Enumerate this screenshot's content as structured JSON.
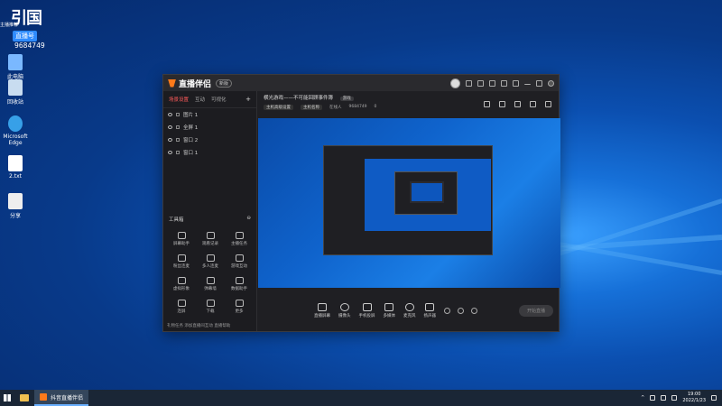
{
  "desktop": {
    "logo": {
      "big_text": "引国",
      "tag_text": "主播推荐",
      "badge_text": "直播号",
      "number": "9684749"
    },
    "icons": [
      {
        "label": "此电脑",
        "color": "#7ab8ff"
      },
      {
        "label": "回收站",
        "color": "#c8dcf0"
      },
      {
        "label": "Microsoft Edge",
        "color": "#37a0e8"
      },
      {
        "label": "2.txt",
        "color": "#ffffff"
      },
      {
        "label": "分享",
        "color": "#eeeeee"
      }
    ]
  },
  "app": {
    "title": "直播伴侣",
    "version": "新版",
    "left_tabs": [
      "场景设置",
      "互动",
      "可视化"
    ],
    "sources": [
      {
        "label": "图片 1"
      },
      {
        "label": "全屏 1"
      },
      {
        "label": "窗口 2"
      },
      {
        "label": "窗口 1"
      }
    ],
    "tools_header": "工具箱",
    "tools": [
      {
        "label": "屏幕助手"
      },
      {
        "label": "观看记录"
      },
      {
        "label": "主播任务"
      },
      {
        "label": "粉丝连麦"
      },
      {
        "label": "多人连麦"
      },
      {
        "label": "游戏互动"
      },
      {
        "label": "虚拟形象"
      },
      {
        "label": "弹幕墙"
      },
      {
        "label": "数据助手"
      },
      {
        "label": "连屏"
      },
      {
        "label": "下载"
      },
      {
        "label": "更多"
      }
    ],
    "left_footer": "礼物任务  添加直播间互动  直播帮助",
    "stream_title": "横光游戏——不可能回顾事件簿",
    "stream_tag": "游戏",
    "info_chips": [
      "主机高级设置",
      "主机名称"
    ],
    "info_live_label": "在线人",
    "info_number": "9684749",
    "info_count": "0",
    "controls": [
      {
        "label": "直播屏幕"
      },
      {
        "label": "摄像头"
      },
      {
        "label": "手机投屏"
      },
      {
        "label": "多媒体"
      },
      {
        "label": "麦克风"
      },
      {
        "label": "扬声器"
      }
    ],
    "live_button": "开始直播"
  },
  "taskbar": {
    "task_label": "抖音直播伴侣",
    "time": "19:00",
    "date": "2022/1/23"
  },
  "colors": {
    "accent": "#ff5b5b",
    "brand": "#ff7a1a",
    "desktop_blue": "#0b4fb0"
  }
}
